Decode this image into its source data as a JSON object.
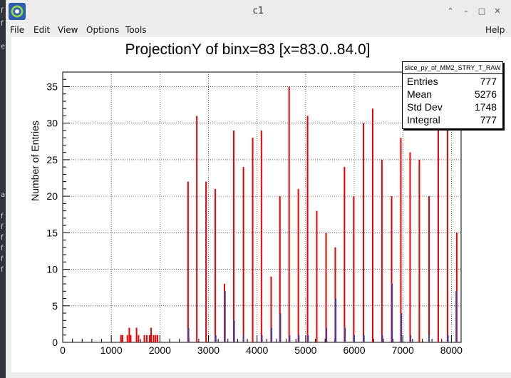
{
  "window": {
    "title": "c1"
  },
  "menu": {
    "file": "File",
    "edit": "Edit",
    "view": "View",
    "options": "Options",
    "tools": "Tools",
    "help": "Help"
  },
  "stats": {
    "title": "slice_py_of_MM2_STRY_T_RAW",
    "rows": [
      {
        "key": "Entries",
        "value": "777"
      },
      {
        "key": "Mean",
        "value": "5276"
      },
      {
        "key": "Std Dev",
        "value": "1748"
      },
      {
        "key": "Integral",
        "value": "777"
      }
    ]
  },
  "colors": {
    "red_series": "#ee0000",
    "blue_series": "#4040a0",
    "grid": "#000000"
  },
  "chart_data": {
    "type": "bar",
    "title": "ProjectionY of binx=83 [x=83.0..84.0]",
    "xlabel": "",
    "ylabel": "Number of Entries",
    "xlim": [
      0,
      8200
    ],
    "ylim": [
      0,
      37
    ],
    "xticks": [
      0,
      1000,
      2000,
      3000,
      4000,
      5000,
      6000,
      7000,
      8000
    ],
    "yticks": [
      0,
      5,
      10,
      15,
      20,
      25,
      30,
      35
    ],
    "grid": true,
    "series": [
      {
        "name": "red",
        "color": "#ee0000",
        "points": [
          [
            1200,
            1
          ],
          [
            1230,
            1
          ],
          [
            1330,
            1
          ],
          [
            1370,
            2
          ],
          [
            1400,
            1
          ],
          [
            1520,
            2
          ],
          [
            1560,
            1
          ],
          [
            1680,
            1
          ],
          [
            1730,
            1
          ],
          [
            1790,
            1
          ],
          [
            1820,
            2
          ],
          [
            1870,
            1
          ],
          [
            1910,
            1
          ],
          [
            1950,
            1
          ],
          [
            2580,
            22
          ],
          [
            2760,
            31
          ],
          [
            2950,
            22
          ],
          [
            3140,
            21
          ],
          [
            3330,
            8
          ],
          [
            3520,
            29
          ],
          [
            3720,
            24
          ],
          [
            3910,
            28
          ],
          [
            4090,
            29
          ],
          [
            4290,
            9
          ],
          [
            4470,
            20
          ],
          [
            4660,
            35
          ],
          [
            4850,
            21
          ],
          [
            5040,
            31
          ],
          [
            5230,
            18
          ],
          [
            5420,
            15
          ],
          [
            5610,
            13
          ],
          [
            5800,
            24
          ],
          [
            5990,
            20
          ],
          [
            6190,
            30
          ],
          [
            6380,
            32
          ],
          [
            6570,
            25
          ],
          [
            6770,
            20
          ],
          [
            6960,
            28
          ],
          [
            7150,
            26
          ],
          [
            7340,
            25
          ],
          [
            7540,
            20
          ],
          [
            7730,
            30
          ],
          [
            7920,
            31
          ],
          [
            8110,
            15
          ]
        ]
      },
      {
        "name": "blue",
        "color": "#4040a0",
        "points": [
          [
            2590,
            2
          ],
          [
            3150,
            1
          ],
          [
            3340,
            7
          ],
          [
            3530,
            3
          ],
          [
            3720,
            1
          ],
          [
            4100,
            1
          ],
          [
            4300,
            2
          ],
          [
            4480,
            4
          ],
          [
            4670,
            1
          ],
          [
            4860,
            1
          ],
          [
            5050,
            1
          ],
          [
            5430,
            2
          ],
          [
            5620,
            6
          ],
          [
            5810,
            2
          ],
          [
            6000,
            1
          ],
          [
            6200,
            1
          ],
          [
            6580,
            1
          ],
          [
            6780,
            8
          ],
          [
            6970,
            4
          ],
          [
            7160,
            1
          ],
          [
            7540,
            1
          ],
          [
            7930,
            1
          ],
          [
            8100,
            7
          ]
        ]
      }
    ],
    "stats": {
      "entries": 777,
      "mean": 5276,
      "std_dev": 1748,
      "integral": 777
    }
  }
}
